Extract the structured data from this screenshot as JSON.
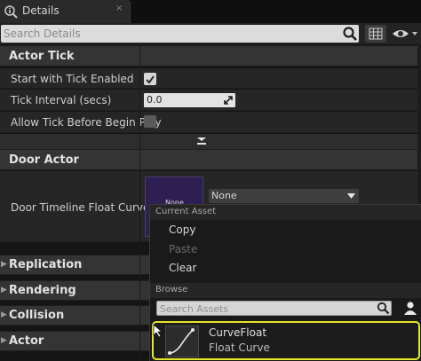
{
  "tab": {
    "title": "Details",
    "icon": "magnifier-info-icon"
  },
  "search": {
    "placeholder": "Search Details"
  },
  "categories": {
    "actor_tick": "Actor Tick",
    "door_actor": "Door Actor",
    "replication": "Replication",
    "rendering": "Rendering",
    "collision": "Collision",
    "actor": "Actor"
  },
  "actor_tick": {
    "start_with_tick_label": "Start with Tick Enabled",
    "start_with_tick_checked": true,
    "tick_interval_label": "Tick Interval (secs)",
    "tick_interval_value": "0.0",
    "allow_tick_label": "Allow Tick Before Begin Play",
    "allow_tick_checked": false
  },
  "door_actor": {
    "curve_label": "Door Timeline Float Curve",
    "thumb_text": "None",
    "combo_value": "None"
  },
  "popup": {
    "current_asset_header": "Current Asset",
    "copy": "Copy",
    "paste": "Paste",
    "clear": "Clear",
    "browse_header": "Browse",
    "search_placeholder": "Search Assets",
    "asset": {
      "name": "CurveFloat",
      "type": "Float Curve"
    }
  },
  "colors": {
    "highlight": "#e6e62a",
    "thumb_bg": "#2e1f52",
    "panel_bg": "#262626",
    "category_bg": "#343434"
  }
}
